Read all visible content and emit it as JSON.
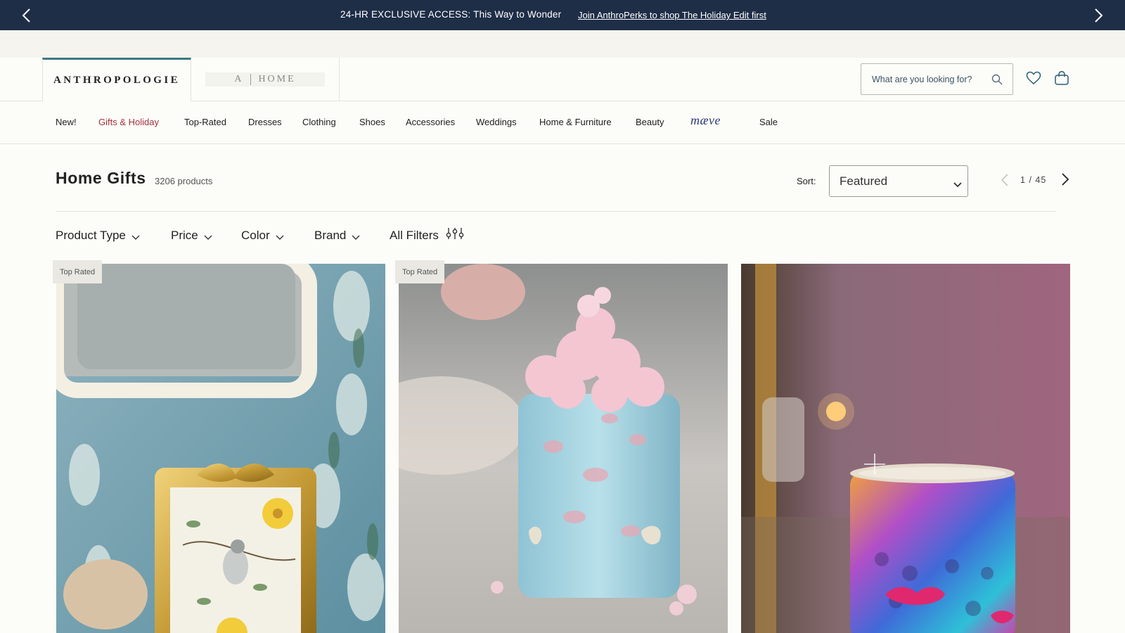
{
  "promo": {
    "message": "24-HR EXCLUSIVE ACCESS: This Way to Wonder",
    "link": "Join AnthroPerks to shop The Holiday Edit first"
  },
  "header": {
    "brand": "ANTHROPOLOGIE",
    "home_brand_left": "A",
    "home_brand_right": "HOME",
    "search_placeholder": "What are you looking for?"
  },
  "nav": {
    "items": [
      "New!",
      "Gifts & Holiday",
      "Top-Rated",
      "Dresses",
      "Clothing",
      "Shoes",
      "Accessories",
      "Weddings",
      "Home & Furniture",
      "Beauty",
      "Sale"
    ],
    "maeve": "mæve",
    "active": "Gifts & Holiday",
    "active_color": "#a4333f"
  },
  "listing": {
    "title": "Home Gifts",
    "count": "3206 products",
    "sort_label": "Sort:",
    "sort_value": "Featured",
    "page_current": "1",
    "page_total": "45",
    "page_sep": "/"
  },
  "filters": {
    "product_type": "Product Type",
    "price": "Price",
    "color": "Color",
    "brand": "Brand",
    "all_filters": "All Filters"
  },
  "products": [
    {
      "badge": "Top Rated",
      "image": "gold bow picture frame with bird print"
    },
    {
      "badge": "Top Rated",
      "image": "pink blue glass candle tumbler"
    },
    {
      "badge": "",
      "image": "iridescent lips glass candle"
    }
  ],
  "colors": {
    "banner": "#1f2e47",
    "accent_teal": "#3b7a83",
    "background": "#fcfcf8"
  }
}
